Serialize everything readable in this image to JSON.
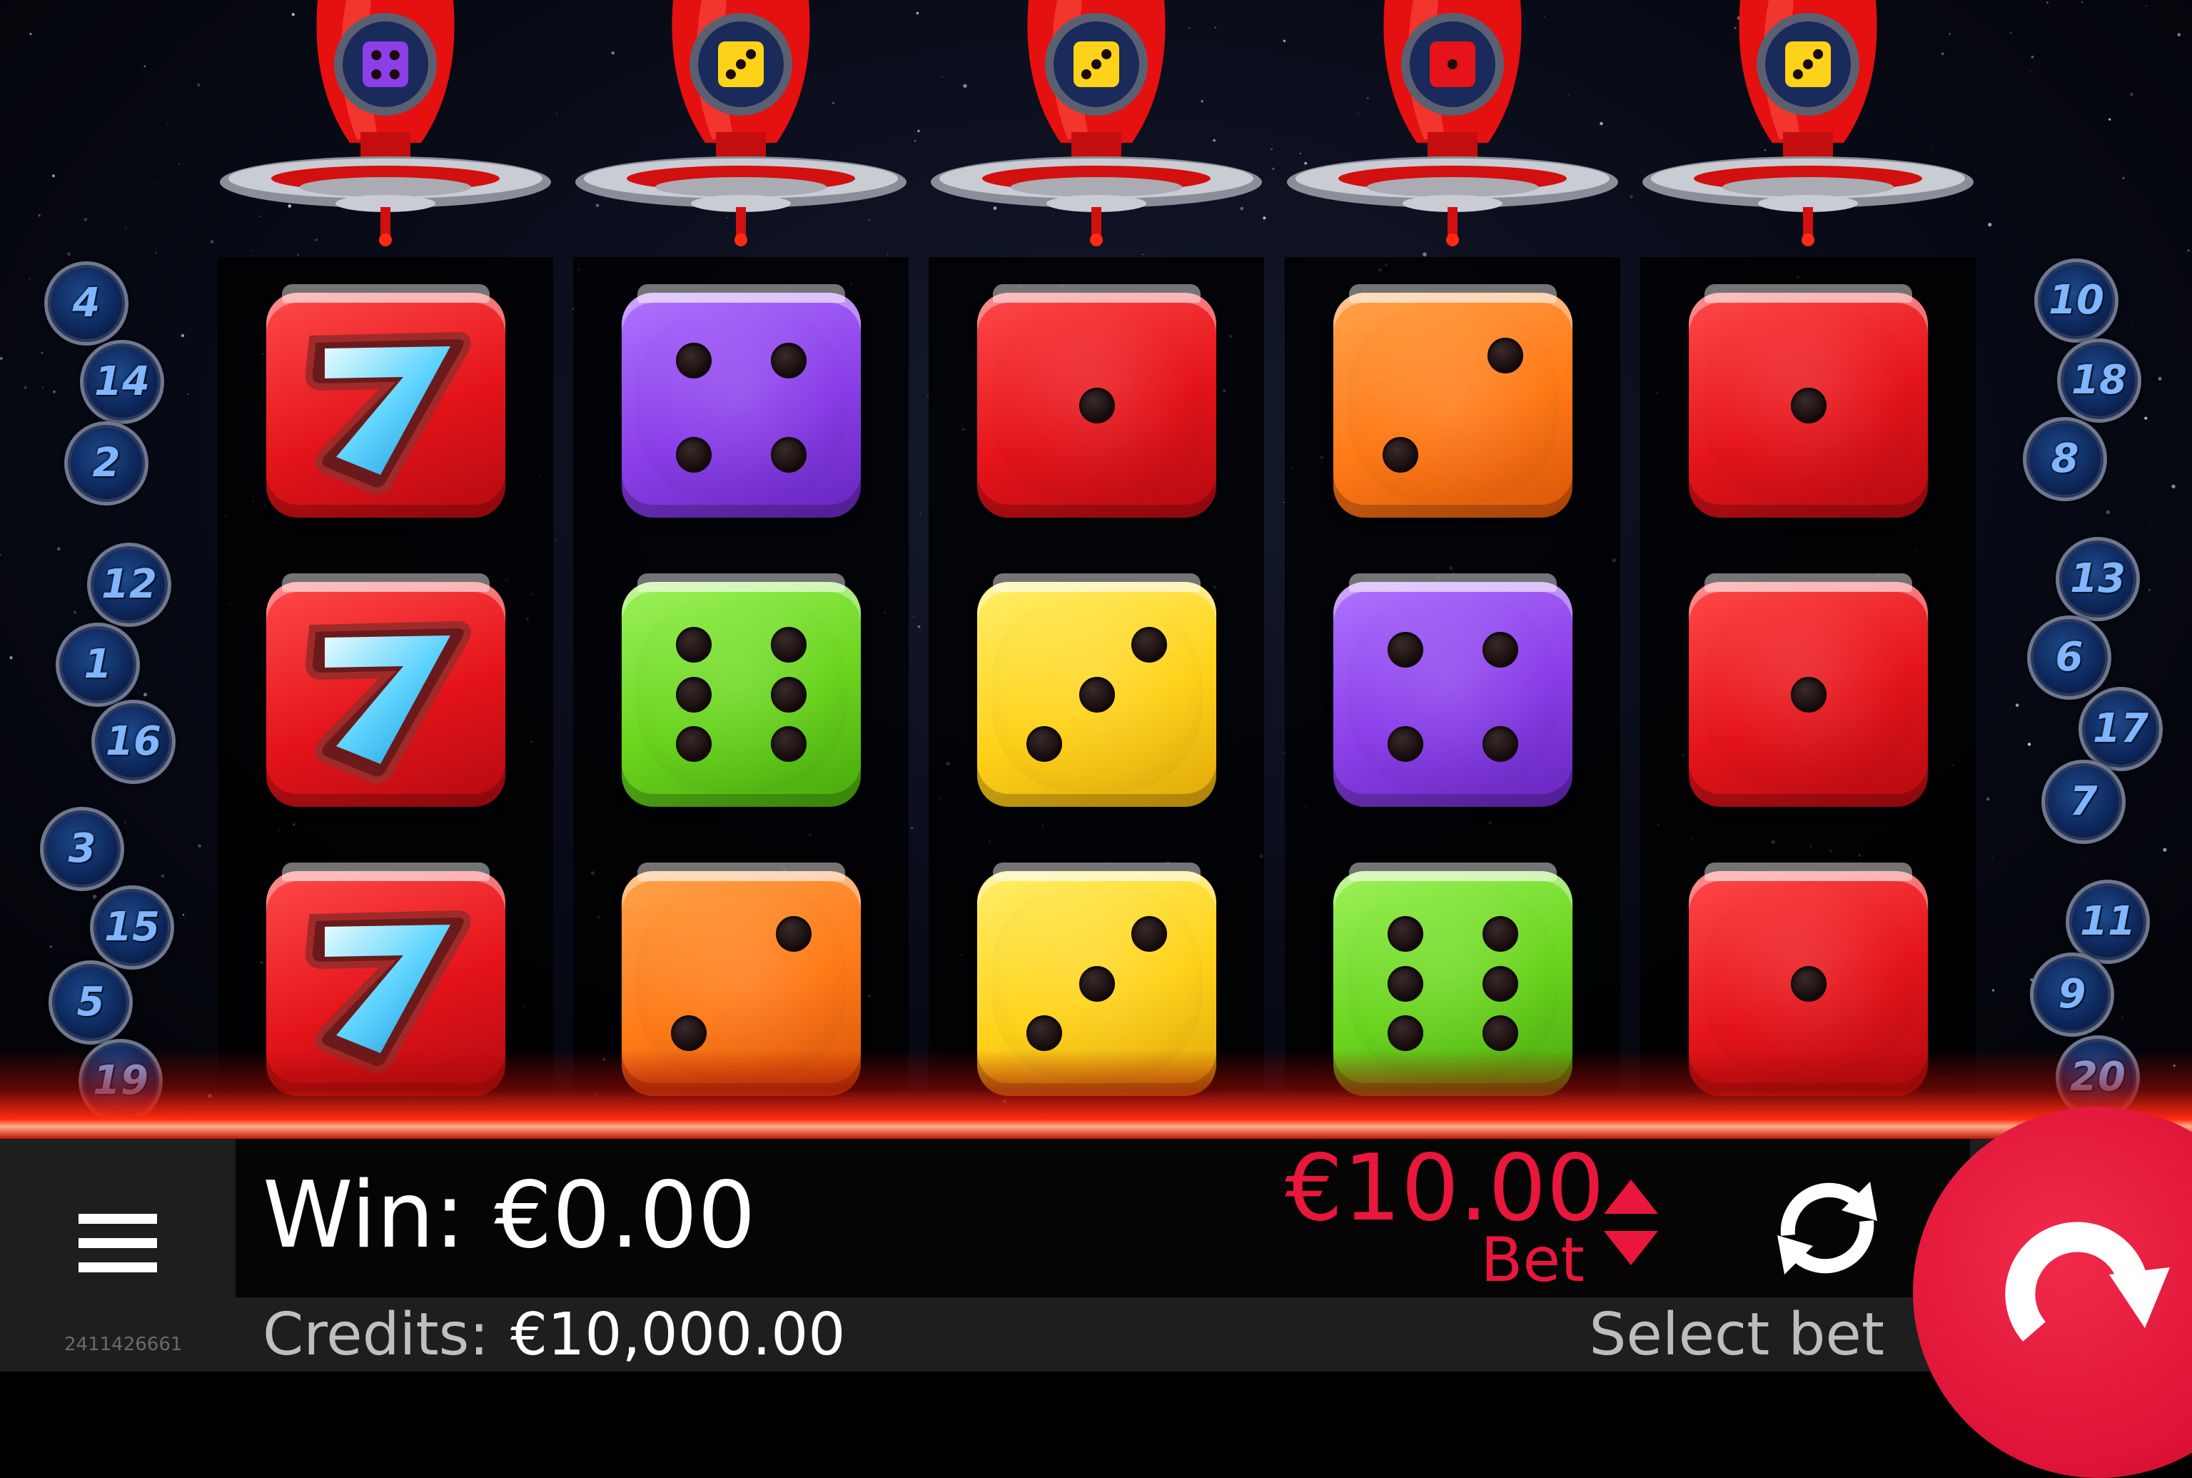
{
  "game": {
    "reels": [
      {
        "ship_die": {
          "color": "purple",
          "value": 4
        },
        "symbols": [
          {
            "kind": "seven"
          },
          {
            "kind": "seven"
          },
          {
            "kind": "seven"
          }
        ]
      },
      {
        "ship_die": {
          "color": "yellow",
          "value": 3
        },
        "symbols": [
          {
            "kind": "die",
            "color": "purple",
            "value": 4
          },
          {
            "kind": "die",
            "color": "green",
            "value": 6
          },
          {
            "kind": "die",
            "color": "orange",
            "value": 2
          }
        ]
      },
      {
        "ship_die": {
          "color": "yellow",
          "value": 3
        },
        "symbols": [
          {
            "kind": "die",
            "color": "red",
            "value": 1
          },
          {
            "kind": "die",
            "color": "yellow",
            "value": 3
          },
          {
            "kind": "die",
            "color": "yellow",
            "value": 3
          }
        ]
      },
      {
        "ship_die": {
          "color": "red",
          "value": 1
        },
        "symbols": [
          {
            "kind": "die",
            "color": "orange",
            "value": 2
          },
          {
            "kind": "die",
            "color": "purple",
            "value": 4
          },
          {
            "kind": "die",
            "color": "green",
            "value": 6
          }
        ]
      },
      {
        "ship_die": {
          "color": "yellow",
          "value": 3
        },
        "symbols": [
          {
            "kind": "die",
            "color": "red",
            "value": 1
          },
          {
            "kind": "die",
            "color": "red",
            "value": 1
          },
          {
            "kind": "die",
            "color": "red",
            "value": 1
          }
        ]
      }
    ],
    "paylines_left": [
      "4",
      "14",
      "2",
      "12",
      "1",
      "16",
      "3",
      "15",
      "5",
      "19"
    ],
    "paylines_right": [
      "10",
      "18",
      "8",
      "13",
      "6",
      "17",
      "7",
      "11",
      "9",
      "20"
    ]
  },
  "footer": {
    "win_label": "Win: €0.00",
    "credits_label": "Credits:",
    "credits_value": "€10,000.00",
    "bet_value": "€10.00",
    "bet_label": "Bet",
    "select_bet": "Select bet",
    "build_id": "2411426661"
  },
  "colors": {
    "accent": "#e8173b",
    "bar": "#1e1e1e",
    "win_panel": "#050505",
    "red": "#e4141a",
    "purple": "#8a3fe8",
    "orange": "#ff7a18",
    "green": "#6ad41f",
    "yellow": "#ffd21a"
  },
  "icons": {
    "menu": "hamburger-icon",
    "bet_up": "triangle-up-icon",
    "bet_down": "triangle-down-icon",
    "autoplay": "autoplay-arrows-icon",
    "spin": "spin-arrow-icon"
  }
}
